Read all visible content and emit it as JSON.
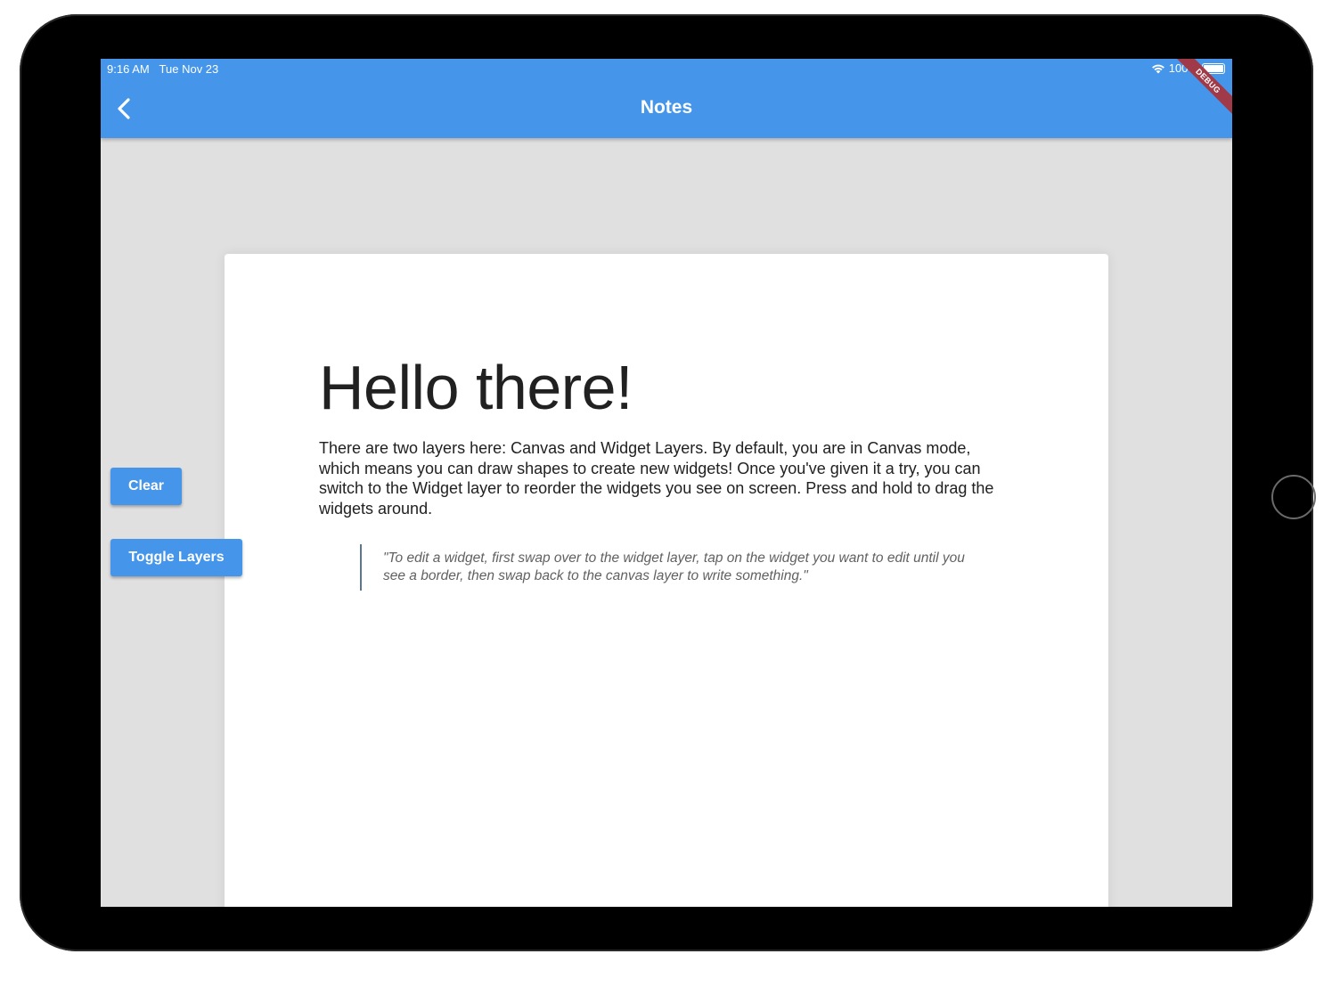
{
  "status_bar": {
    "time": "9:16 AM",
    "date": "Tue Nov 23",
    "battery": "100%",
    "icons": [
      "wifi-icon",
      "battery-icon"
    ]
  },
  "app_bar": {
    "title": "Notes",
    "back_icon": "chevron-left-icon",
    "debug_label": "DEBUG"
  },
  "note": {
    "heading": "Hello there!",
    "body": "There are two layers here: Canvas and Widget Layers. By default, you are in Canvas mode, which means you can draw shapes to create new widgets! Once you've given it a try, you can switch to the Widget layer to reorder the widgets you see on screen. Press and hold to drag the widgets around.",
    "quote": "\"To edit a widget, first swap over to the widget layer, tap on the widget you want to edit until you see a border, then swap back to the canvas layer to write something.\""
  },
  "controls": {
    "clear_label": "Clear",
    "toggle_label": "Toggle Layers"
  },
  "colors": {
    "accent": "#4596ea",
    "background": "#e0e0e0",
    "debug_banner": "#a03a48"
  }
}
